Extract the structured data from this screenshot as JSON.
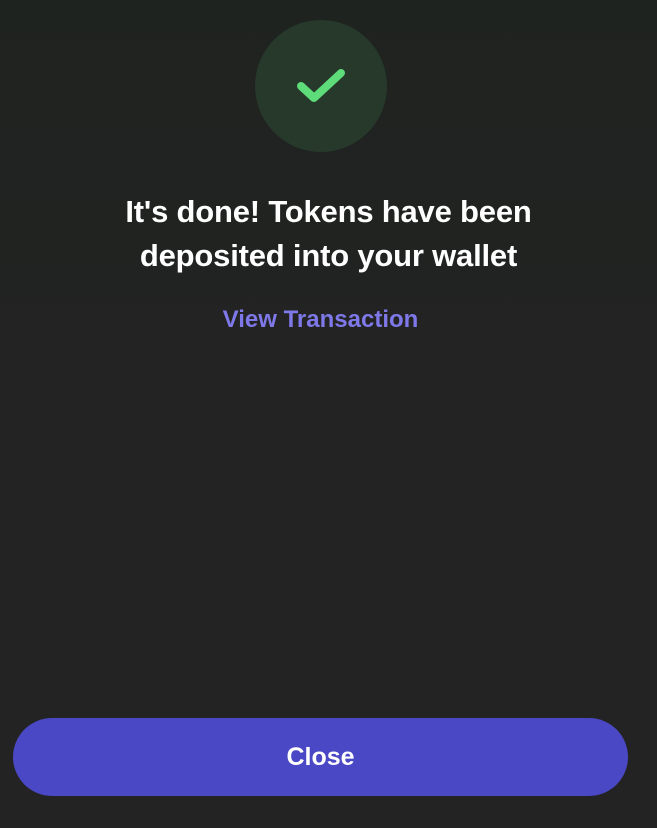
{
  "status": {
    "icon": "checkmark-icon",
    "badge_color": "#26392b",
    "check_color": "#5edc7a"
  },
  "message": {
    "line1": "It's done! Tokens have been",
    "line2": "deposited into your wallet"
  },
  "links": {
    "view_transaction": "View Transaction",
    "link_color": "#7e78e8"
  },
  "actions": {
    "close_label": "Close",
    "button_color": "#4a48c4"
  }
}
